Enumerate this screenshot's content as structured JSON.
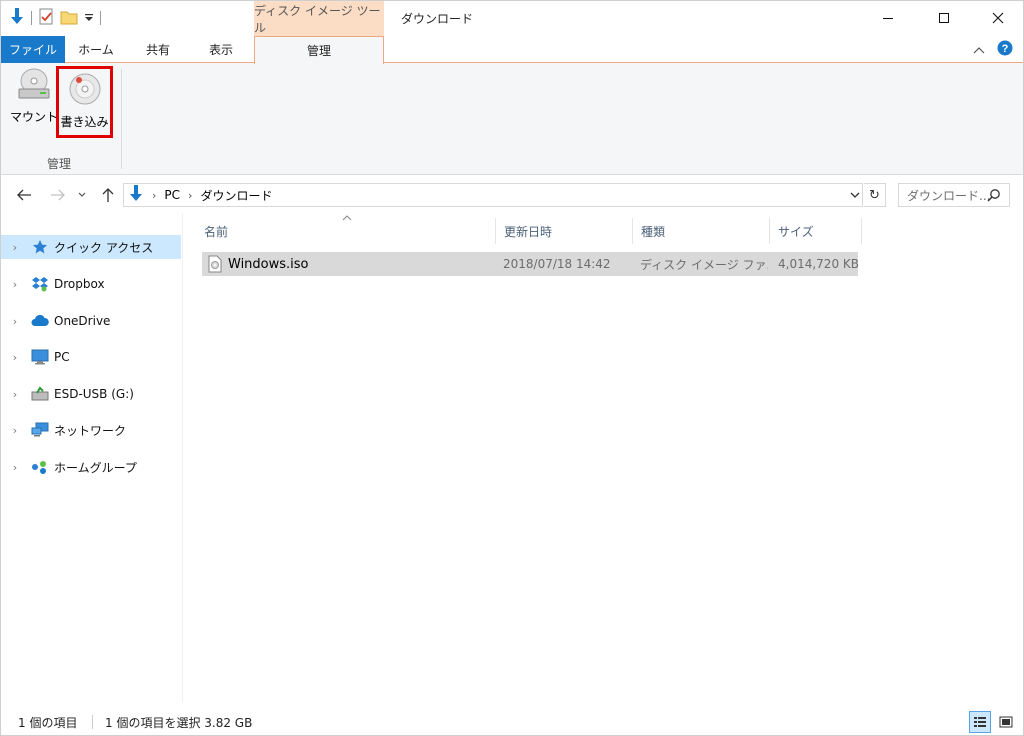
{
  "titlebar": {
    "context_header": "ディスク イメージ ツール",
    "window_title": "ダウンロード"
  },
  "ribbon": {
    "tabs": [
      "ファイル",
      "ホーム",
      "共有",
      "表示",
      "管理"
    ],
    "active_tab": "管理",
    "buttons": [
      {
        "label": "マウント",
        "icon": "disc-drive-icon"
      },
      {
        "label": "書き込み",
        "icon": "burn-disc-icon"
      }
    ],
    "group_label": "管理"
  },
  "address": {
    "path": [
      "PC",
      "ダウンロード"
    ],
    "search_placeholder": "ダウンロード..."
  },
  "nav_pane": {
    "items": [
      {
        "label": "クイック アクセス",
        "icon": "star-icon",
        "selected": true
      },
      {
        "label": "Dropbox",
        "icon": "dropbox-icon"
      },
      {
        "label": "OneDrive",
        "icon": "cloud-icon"
      },
      {
        "label": "PC",
        "icon": "computer-icon"
      },
      {
        "label": "ESD-USB (G:)",
        "icon": "usb-drive-icon"
      },
      {
        "label": "ネットワーク",
        "icon": "network-icon"
      },
      {
        "label": "ホームグループ",
        "icon": "homegroup-icon"
      }
    ]
  },
  "file_list": {
    "columns": [
      "名前",
      "更新日時",
      "種類",
      "サイズ"
    ],
    "rows": [
      {
        "name": "Windows.iso",
        "modified": "2018/07/18 14:42",
        "type": "ディスク イメージ ファ...",
        "size": "4,014,720 KB",
        "selected": true
      }
    ]
  },
  "status": {
    "item_count": "1 個の項目",
    "selection": "1 個の項目を選択  3.82 GB"
  },
  "colors": {
    "accent": "#1979ca",
    "context_tab": "#fbdcc4",
    "selection": "#cce8ff",
    "highlight_box": "#e00000"
  }
}
